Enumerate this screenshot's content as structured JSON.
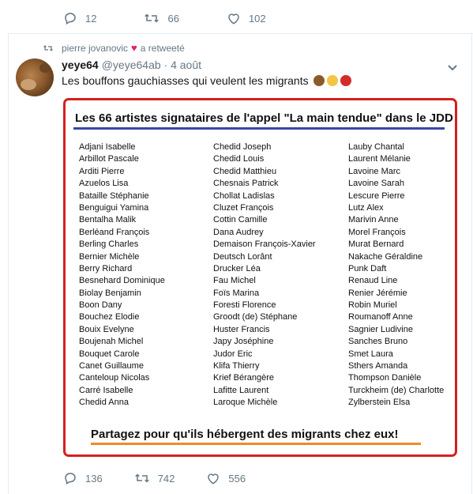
{
  "top_actions": {
    "replies": "12",
    "retweets": "66",
    "likes": "102"
  },
  "retweet_line": {
    "user": "pierre jovanovic",
    "suffix": "a retweeté"
  },
  "tweet": {
    "display_name": "yeye64",
    "handle_date": "@yeye64ab · 4 août",
    "text": "Les bouffons gauchiasses qui veulent les migrants",
    "emoji": [
      "poo",
      "thumbs-down",
      "angry-face"
    ]
  },
  "card": {
    "title": "Les 66 artistes signataires de l'appel \"La main tendue\" dans le JDD",
    "col1": [
      "Adjani Isabelle",
      "Arbillot Pascale",
      "Arditi Pierre",
      "Azuelos Lisa",
      "Bataille Stéphanie",
      "Benguigui Yamina",
      "Bentalha Malik",
      "Berléand François",
      "Berling Charles",
      "Bernier Michèle",
      "Berry Richard",
      "Besnehard Dominique",
      "Biolay Benjamin",
      "Boon Dany",
      "Bouchez Elodie",
      "Bouix Evelyne",
      "Boujenah Michel",
      "Bouquet Carole",
      "Canet Guillaume",
      "Canteloup Nicolas",
      "Carré Isabelle",
      "Chedid Anna"
    ],
    "col2": [
      "Chedid Joseph",
      "Chedid Louis",
      "Chedid Matthieu",
      "Chesnais Patrick",
      "Chollat Ladislas",
      "Cluzet François",
      "Cottin Camille",
      "Dana Audrey",
      "Demaison François-Xavier",
      "Deutsch Lorânt",
      "Drucker Léa",
      "Fau Michel",
      "Foïs Marina",
      "Foresti Florence",
      "Groodt (de) Stéphane",
      "Huster Francis",
      "Japy Joséphine",
      "Judor Eric",
      "Klifa Thierry",
      "Krief Bérangère",
      "Lafitte Laurent",
      "Laroque Michèle"
    ],
    "col3": [
      "Lauby Chantal",
      "Laurent Mélanie",
      "Lavoine Marc",
      "Lavoine Sarah",
      "Lescure Pierre",
      "Lutz Alex",
      "Marivin Anne",
      "Morel François",
      "Murat Bernard",
      "Nakache Géraldine",
      "Punk Daft",
      "Renaud Line",
      "Renier Jérémie",
      "Robin Muriel",
      "Roumanoff Anne",
      "Sagnier Ludivine",
      "Sanches Bruno",
      "Smet Laura",
      "Sthers Amanda",
      "Thompson Danièle",
      "Turckheim (de) Charlotte",
      "Zylberstein Elsa"
    ],
    "footer": "Partagez pour qu'ils hébergent des migrants chez eux!"
  },
  "bottom_actions": {
    "replies": "136",
    "retweets": "742",
    "likes": "556"
  },
  "colors": {
    "accent_red": "#d42020",
    "underline_blue": "#3a46a8",
    "underline_orange": "#ee8a2b",
    "muted": "#657786"
  }
}
